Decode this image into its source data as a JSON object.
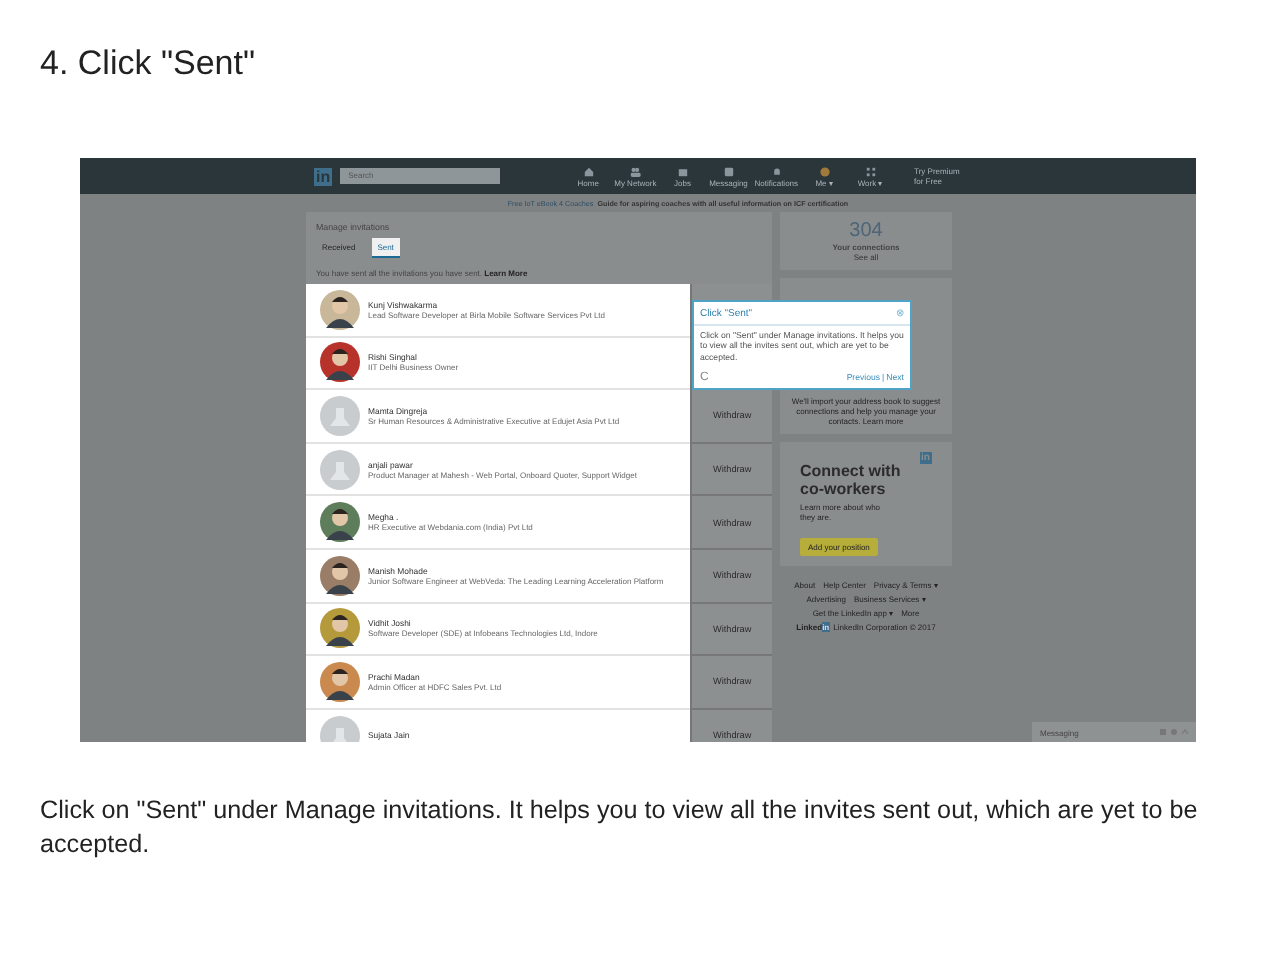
{
  "slide": {
    "title": "4. Click \"Sent\"",
    "caption": "Click on \"Sent\" under Manage invitations. It helps you to view all the invites sent out, which are yet to be accepted."
  },
  "nav": {
    "logo": "in",
    "search": {
      "placeholder": "Search"
    },
    "items": [
      {
        "label": "Home"
      },
      {
        "label": "My Network"
      },
      {
        "label": "Jobs"
      },
      {
        "label": "Messaging"
      },
      {
        "label": "Notifications"
      },
      {
        "label": "Me ▾"
      },
      {
        "label": "Work ▾"
      }
    ],
    "premium": "Try Premium for Free"
  },
  "banner": {
    "link": "Free IoT eBook 4 Coaches",
    "text": "Guide for aspiring coaches with all useful information on ICF certification"
  },
  "invitations": {
    "title": "Manage invitations",
    "tabs": [
      {
        "label": "Received",
        "selected": false
      },
      {
        "label": "Sent",
        "selected": true
      }
    ],
    "note": "You have sent all the invitations you have sent.",
    "note_link": "Learn More",
    "people": [
      {
        "name": "Kunj Vishwakarma",
        "headline": "Lead Software Developer at Birla Mobile Software Services Pvt Ltd",
        "kind": "picture"
      },
      {
        "name": "Rishi Singhal",
        "headline": "IIT Delhi Business Owner",
        "kind": "picture"
      },
      {
        "name": "Mamta Dingreja",
        "headline": "Sr Human Resources & Administrative Executive at Edujet Asia Pvt Ltd",
        "kind": "placeholder",
        "withdraw": "Withdraw"
      },
      {
        "name": "anjali pawar",
        "headline": "Product Manager at Mahesh - Web Portal, Onboard Quoter, Support Widget",
        "kind": "placeholder",
        "withdraw": "Withdraw"
      },
      {
        "name": "Megha .",
        "headline": "HR Executive at Webdania.com (India) Pvt Ltd",
        "kind": "picture",
        "withdraw": "Withdraw"
      },
      {
        "name": "Manish Mohade",
        "headline": "Junior Software Engineer at WebVeda: The Leading Learning Acceleration Platform",
        "kind": "picture",
        "withdraw": "Withdraw"
      },
      {
        "name": "Vidhit Joshi",
        "headline": "Software Developer (SDE) at Infobeans Technologies Ltd, Indore",
        "kind": "picture",
        "withdraw": "Withdraw"
      },
      {
        "name": "Prachi Madan",
        "headline": "Admin Officer at HDFC Sales Pvt. Ltd",
        "kind": "picture",
        "withdraw": "Withdraw"
      },
      {
        "name": "Sujata Jain",
        "kind": "placeholder",
        "withdraw": "Withdraw"
      }
    ]
  },
  "connections": {
    "count": "304",
    "label": "Your connections",
    "link": "See all"
  },
  "import": {
    "text": "We'll import your address book to suggest connections and help you manage your contacts. Learn more"
  },
  "ad": {
    "logo": "in",
    "title": "Connect with co-workers",
    "text": "Learn more about who they are.",
    "button": "Add your position"
  },
  "footer": {
    "links": [
      "About",
      "Help Center",
      "Privacy & Terms ▾",
      "Advertising",
      "Business Services ▾",
      "Get the LinkedIn app ▾",
      "More"
    ],
    "brand": "Linked",
    "brand_box": "in",
    "copyright": "LinkedIn Corporation © 2017"
  },
  "messaging": {
    "label": "Messaging"
  },
  "tooltip": {
    "title": "Click \"Sent\"",
    "close": "⊗",
    "body": "Click on \"Sent\" under Manage invitations. It helps you to view all the invites sent out, which are yet to be accepted.",
    "spinner": "C",
    "previous": "Previous",
    "separator": "|",
    "next": "Next"
  }
}
